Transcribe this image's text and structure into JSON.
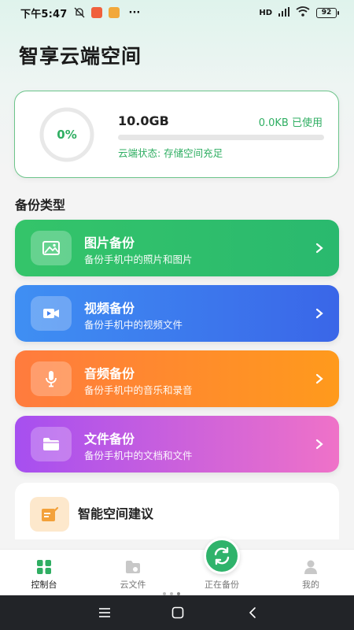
{
  "status_bar": {
    "time": "下午5:47",
    "network": "HD",
    "battery": "92",
    "more": "···"
  },
  "page": {
    "title": "智享云端空间"
  },
  "storage": {
    "percent": "0%",
    "percent_value": 0,
    "total": "10.0GB",
    "used": "0.0KB 已使用",
    "status": "云端状态: 存储空间充足"
  },
  "section": {
    "title": "备份类型"
  },
  "backup_types": [
    {
      "title": "图片备份",
      "desc": "备份手机中的照片和图片",
      "icon": "image-icon",
      "color": "#34c46a"
    },
    {
      "title": "视频备份",
      "desc": "备份手机中的视频文件",
      "icon": "video-icon",
      "color": "#3f8ff3"
    },
    {
      "title": "音频备份",
      "desc": "备份手机中的音乐和录音",
      "icon": "microphone-icon",
      "color": "#ff8a2e"
    },
    {
      "title": "文件备份",
      "desc": "备份手机中的文档和文件",
      "icon": "folder-icon",
      "color": "#c25fe0"
    }
  ],
  "suggestion": {
    "title": "智能空间建议",
    "icon": "edit-note-icon"
  },
  "bottom_nav": {
    "items": [
      {
        "label": "控制台",
        "icon": "dashboard-icon",
        "active": true
      },
      {
        "label": "云文件",
        "icon": "cloud-folder-icon",
        "active": false
      },
      {
        "label": "正在备份",
        "icon": "sync-icon",
        "active": false
      },
      {
        "label": "我的",
        "icon": "user-icon",
        "active": false
      }
    ]
  },
  "colors": {
    "accent": "#2fae62",
    "photo": "#34c46a",
    "video": "#3f8ff3",
    "audio": "#ff8a2e",
    "file": "#c25fe0"
  }
}
